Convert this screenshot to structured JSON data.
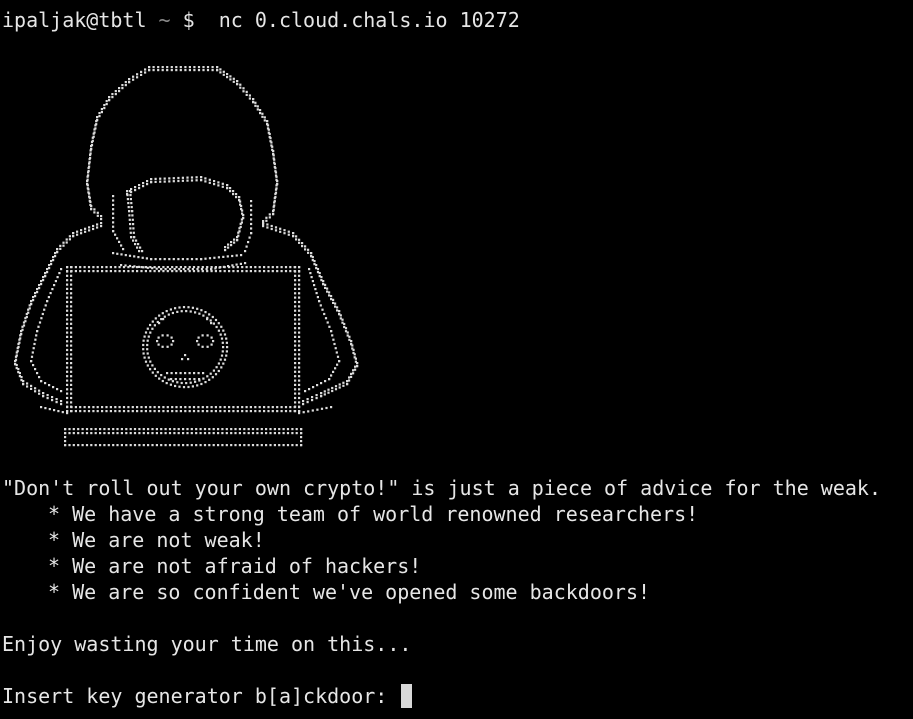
{
  "terminal": {
    "prompt": {
      "user_host": "ipaljak@tbtl",
      "path": " ~ ",
      "symbol": "$",
      "command": "nc 0.cloud.chals.io 10272"
    },
    "art": {
      "icon": "hooded-hacker-dot-ascii-art"
    },
    "output": {
      "quote": "\"Don't roll out your own crypto!\" is just a piece of advice for the weak.",
      "bullets": [
        "* We have a strong team of world renowned researchers!",
        "* We are not weak!",
        "* We are not afraid of hackers!",
        "* We are so confident we've opened some backdoors!"
      ],
      "enjoy": "Enjoy wasting your time on this...",
      "input_prompt": "Insert key generator b[a]ckdoor: "
    },
    "colors": {
      "background": "#000000",
      "foreground": "#e6e6e6",
      "dim": "#8a8a8a"
    }
  }
}
